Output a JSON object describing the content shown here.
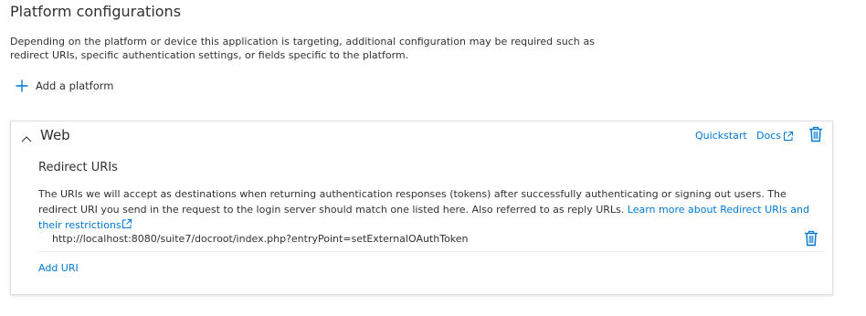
{
  "section": {
    "title": "Platform configurations",
    "description": "Depending on the platform or device this application is targeting, additional configuration may be required such as redirect URIs, specific authentication settings, or fields specific to the platform."
  },
  "add_platform": {
    "label": "Add a platform",
    "icon": "plus-icon"
  },
  "web_card": {
    "name": "Web",
    "quickstart_label": "Quickstart",
    "docs_label": "Docs",
    "redirect": {
      "heading": "Redirect URIs",
      "description": "The URIs we will accept as destinations when returning authentication responses (tokens) after successfully authenticating or signing out users. The redirect URI you send in the request to the login server should match one listed here. Also referred to as reply URLs.",
      "learn_more_label": "Learn more about Redirect URIs and their restrictions",
      "uris": [
        "http://localhost:8080/suite7/docroot/index.php?entryPoint=setExternalOAuthToken"
      ],
      "add_uri_label": "Add URI"
    }
  },
  "colors": {
    "link": "#0078d4",
    "text": "#323130",
    "border": "#e1dfdd"
  }
}
